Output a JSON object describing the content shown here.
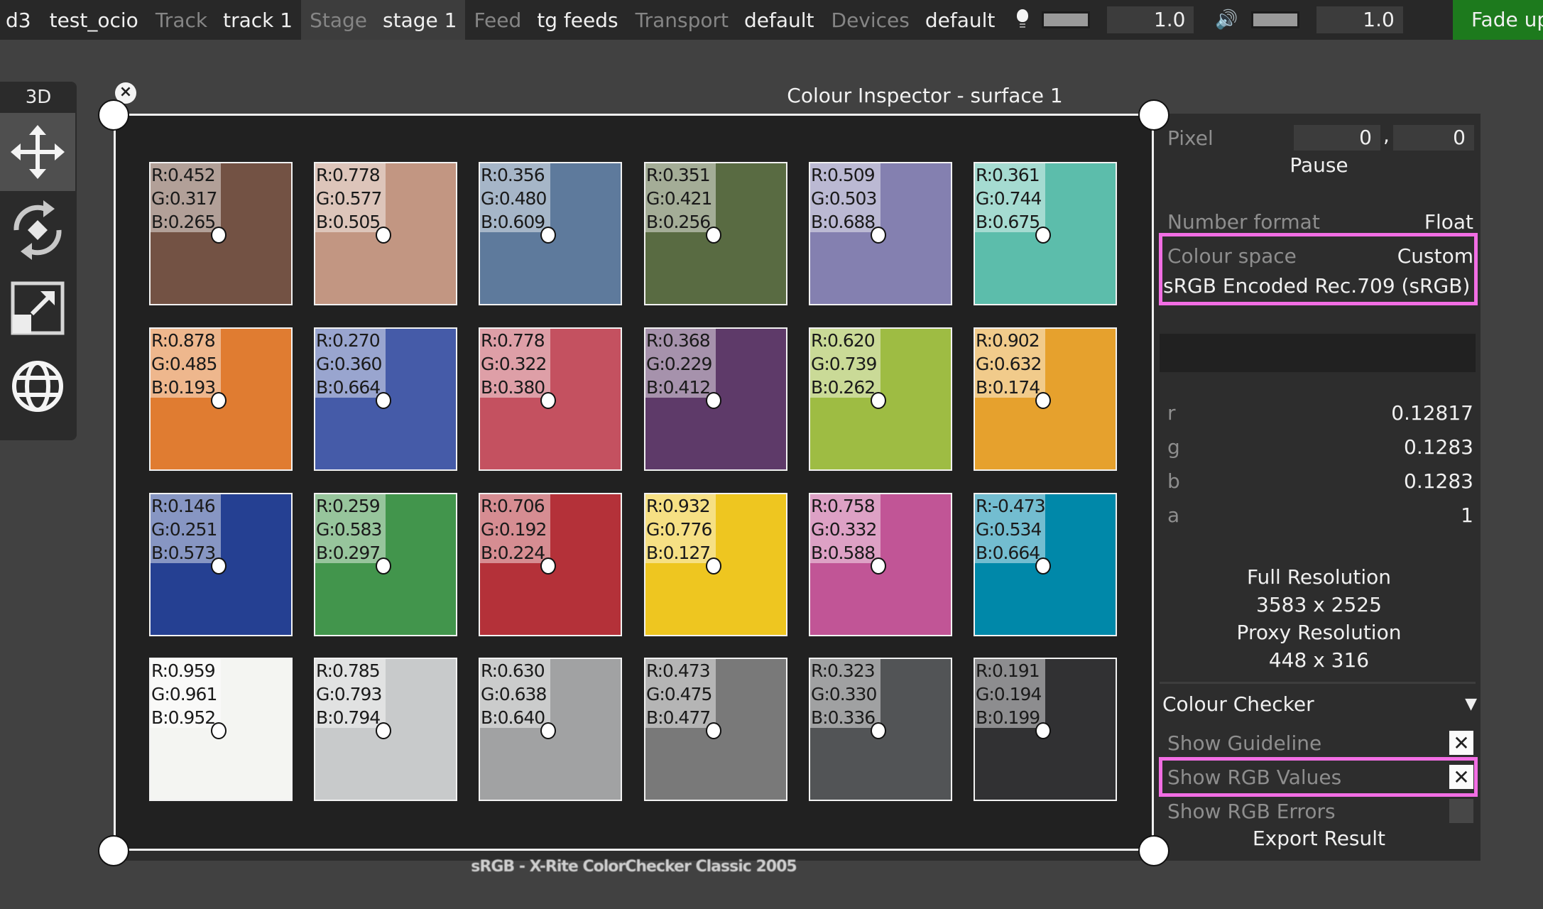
{
  "topbar": {
    "app": "d3",
    "project": "test_ocio",
    "segments": [
      {
        "label": "Track",
        "value": "track 1"
      },
      {
        "label": "Stage",
        "value": "stage 1"
      },
      {
        "label": "Feed",
        "value": "tg feeds"
      },
      {
        "label": "Transport",
        "value": "default"
      },
      {
        "label": "Devices",
        "value": "default"
      }
    ],
    "brightness": {
      "icon": "lightbulb-icon",
      "value": "1.0",
      "level": 1.0
    },
    "volume": {
      "icon": "speaker-icon",
      "value": "1.0",
      "level": 1.0
    },
    "fade_button": "Fade up",
    "fade_color": "#1d7a1d"
  },
  "toolpanel": {
    "title": "3D",
    "tools": [
      {
        "name": "move-icon",
        "active": true
      },
      {
        "name": "rotate-icon",
        "active": false
      },
      {
        "name": "scale-icon",
        "active": false
      },
      {
        "name": "globe-icon",
        "active": false
      }
    ]
  },
  "window": {
    "title": "Colour Inspector - surface 1",
    "close_icon": "×"
  },
  "chart": {
    "caption": "sRGB - X-Rite ColorChecker Classic 2005",
    "swatches": [
      {
        "r": "0.452",
        "g": "0.317",
        "b": "0.265",
        "color": "#735244"
      },
      {
        "r": "0.778",
        "g": "0.577",
        "b": "0.505",
        "color": "#c29682"
      },
      {
        "r": "0.356",
        "g": "0.480",
        "b": "0.609",
        "color": "#5e7a9c"
      },
      {
        "r": "0.351",
        "g": "0.421",
        "b": "0.256",
        "color": "#596b42"
      },
      {
        "r": "0.509",
        "g": "0.503",
        "b": "0.688",
        "color": "#8480b0"
      },
      {
        "r": "0.361",
        "g": "0.744",
        "b": "0.675",
        "color": "#5cbdab"
      },
      {
        "r": "0.878",
        "g": "0.485",
        "b": "0.193",
        "color": "#e07c31"
      },
      {
        "r": "0.270",
        "g": "0.360",
        "b": "0.664",
        "color": "#455ba8"
      },
      {
        "r": "0.778",
        "g": "0.322",
        "b": "0.380",
        "color": "#c45160"
      },
      {
        "r": "0.368",
        "g": "0.229",
        "b": "0.412",
        "color": "#5e3a69"
      },
      {
        "r": "0.620",
        "g": "0.739",
        "b": "0.262",
        "color": "#9ebc43"
      },
      {
        "r": "0.902",
        "g": "0.632",
        "b": "0.174",
        "color": "#e6a12d"
      },
      {
        "r": "0.146",
        "g": "0.251",
        "b": "0.573",
        "color": "#254092"
      },
      {
        "r": "0.259",
        "g": "0.583",
        "b": "0.297",
        "color": "#42954c"
      },
      {
        "r": "0.706",
        "g": "0.192",
        "b": "0.224",
        "color": "#b43139"
      },
      {
        "r": "0.932",
        "g": "0.776",
        "b": "0.127",
        "color": "#eec620"
      },
      {
        "r": "0.758",
        "g": "0.332",
        "b": "0.588",
        "color": "#c15596"
      },
      {
        "r": "-0.473",
        "g": "0.534",
        "b": "0.664",
        "color": "#0088a9"
      },
      {
        "r": "0.959",
        "g": "0.961",
        "b": "0.952",
        "color": "#f4f5f2"
      },
      {
        "r": "0.785",
        "g": "0.793",
        "b": "0.794",
        "color": "#c8cacb"
      },
      {
        "r": "0.630",
        "g": "0.638",
        "b": "0.640",
        "color": "#a1a2a3"
      },
      {
        "r": "0.473",
        "g": "0.475",
        "b": "0.477",
        "color": "#797979"
      },
      {
        "r": "0.323",
        "g": "0.330",
        "b": "0.336",
        "color": "#525456"
      },
      {
        "r": "0.191",
        "g": "0.194",
        "b": "0.199",
        "color": "#313133"
      }
    ]
  },
  "inspector": {
    "pixel_label": "Pixel",
    "pixel_x": "0",
    "pixel_sep": ",",
    "pixel_y": "0",
    "pause_button": "Pause",
    "number_format_label": "Number format",
    "number_format_value": "Float",
    "colour_space_label": "Colour space",
    "colour_space_value": "Custom",
    "colour_space_name": "sRGB Encoded Rec.709 (sRGB)",
    "channels": [
      {
        "label": "r",
        "value": "0.12817"
      },
      {
        "label": "g",
        "value": "0.1283"
      },
      {
        "label": "b",
        "value": "0.1283"
      },
      {
        "label": "a",
        "value": "1"
      }
    ],
    "full_res_label": "Full Resolution",
    "full_res_value": "3583 x 2525",
    "proxy_res_label": "Proxy Resolution",
    "proxy_res_value": "448 x 316",
    "checker_section": "Colour Checker",
    "show_guideline_label": "Show Guideline",
    "show_guideline": true,
    "show_rgb_values_label": "Show RGB Values",
    "show_rgb_values": true,
    "show_rgb_errors_label": "Show RGB Errors",
    "show_rgb_errors": false,
    "export_button": "Export Result",
    "check_glyph": "✕",
    "collapse_glyph": "▼",
    "highlight_color": "#f26ee4"
  }
}
